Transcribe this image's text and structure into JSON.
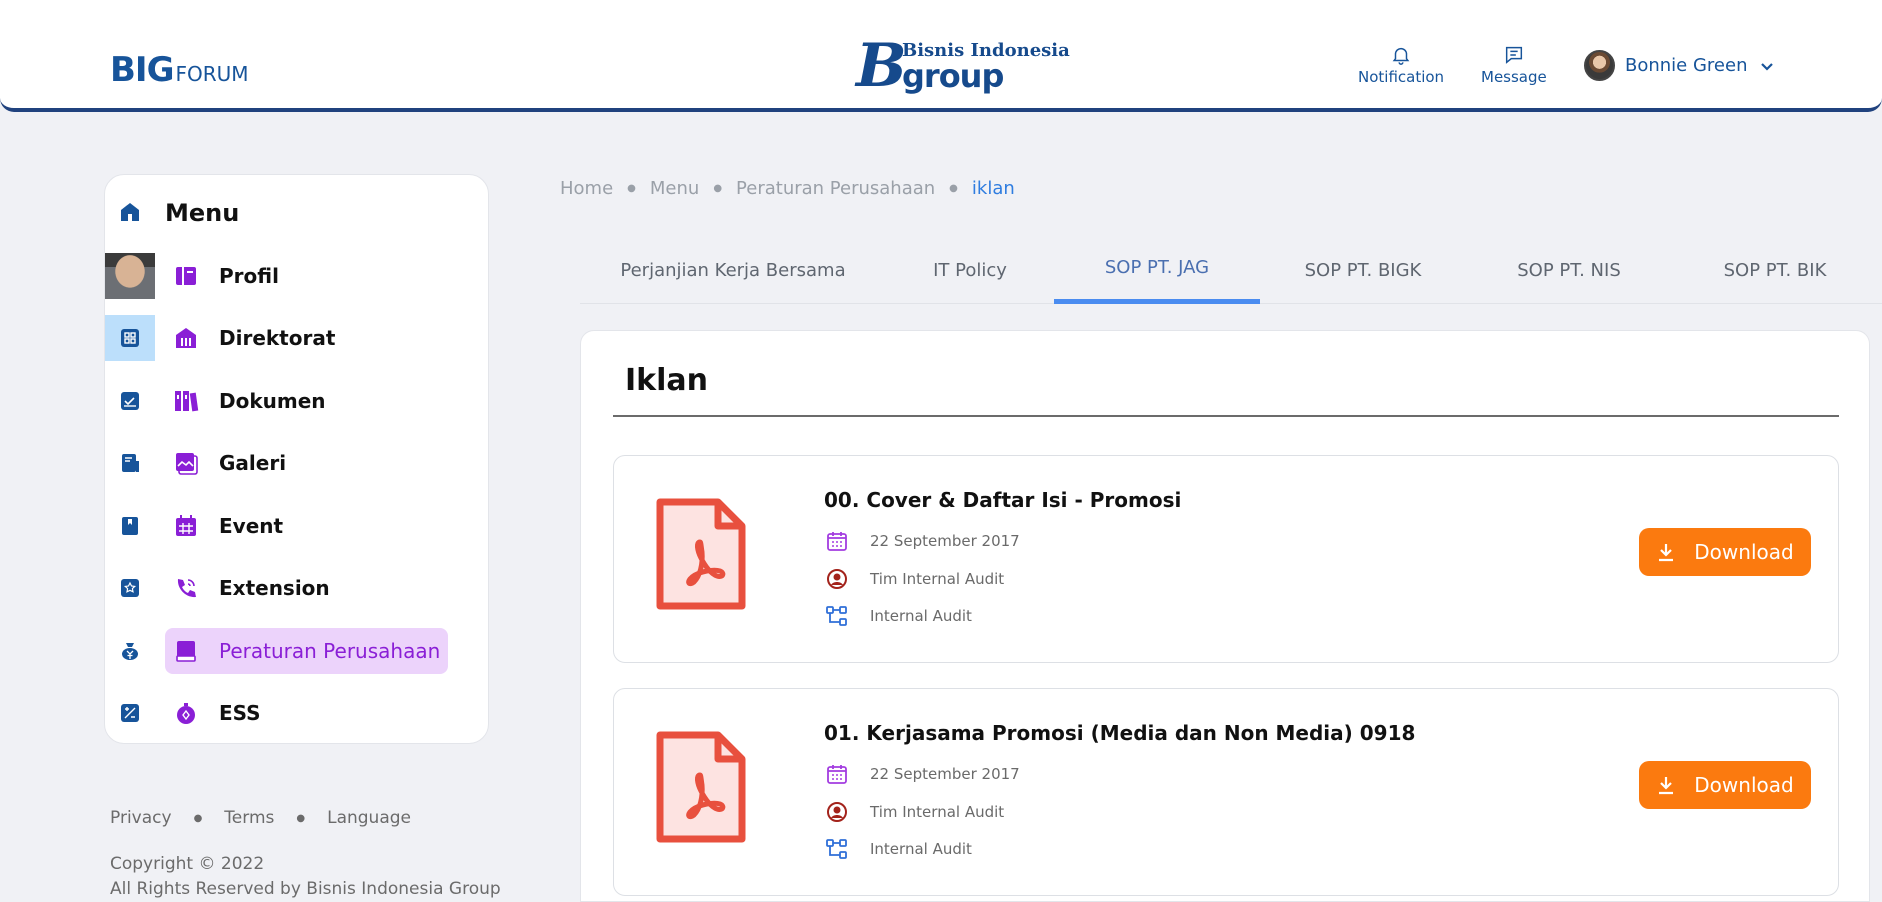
{
  "header": {
    "logo_big": "BIG",
    "logo_forum": "FORUM",
    "brand_top": "Bisnis Indonesia",
    "brand_bottom": "group",
    "brand_mark": "B",
    "notification_label": "Notification",
    "message_label": "Message",
    "user_name": "Bonnie Green"
  },
  "sidebar": {
    "menu_title": "Menu",
    "items": [
      {
        "label": "Profil",
        "icon": "book-icon"
      },
      {
        "label": "Direktorat",
        "icon": "building-icon"
      },
      {
        "label": "Dokumen",
        "icon": "library-icon"
      },
      {
        "label": "Galeri",
        "icon": "gallery-icon"
      },
      {
        "label": "Event",
        "icon": "calendar-icon"
      },
      {
        "label": "Extension",
        "icon": "phone-icon"
      },
      {
        "label": "Peraturan Perusahaan",
        "icon": "book-closed-icon",
        "active": true
      },
      {
        "label": "ESS",
        "icon": "stopwatch-icon"
      }
    ],
    "accent_color": "#8a1fd6",
    "active_bg": "#ecd3fb"
  },
  "footer": {
    "links": [
      "Privacy",
      "Terms",
      "Language"
    ],
    "copyright_line1": "Copyright © 2022",
    "copyright_line2": "All Rights Reserved by Bisnis Indonesia Group"
  },
  "breadcrumb": {
    "items": [
      "Home",
      "Menu",
      "Peraturan Perusahaan"
    ],
    "current": "iklan"
  },
  "tabs": [
    {
      "label": "Perjanjian Kerja Bersama"
    },
    {
      "label": "IT Policy"
    },
    {
      "label": "SOP PT. JAG",
      "active": true
    },
    {
      "label": "SOP PT. BIGK"
    },
    {
      "label": "SOP PT. NIS"
    },
    {
      "label": "SOP PT. BIK"
    }
  ],
  "panel": {
    "title": "Iklan",
    "download_label": "Download",
    "download_color": "#fb7a0f",
    "documents": [
      {
        "title": "00. Cover & Daftar Isi - Promosi",
        "date": "22 September 2017",
        "author": "Tim Internal Audit",
        "department": "Internal Audit"
      },
      {
        "title": "01. Kerjasama Promosi (Media dan Non Media) 0918",
        "date": "22 September 2017",
        "author": "Tim Internal Audit",
        "department": "Internal Audit"
      }
    ]
  }
}
